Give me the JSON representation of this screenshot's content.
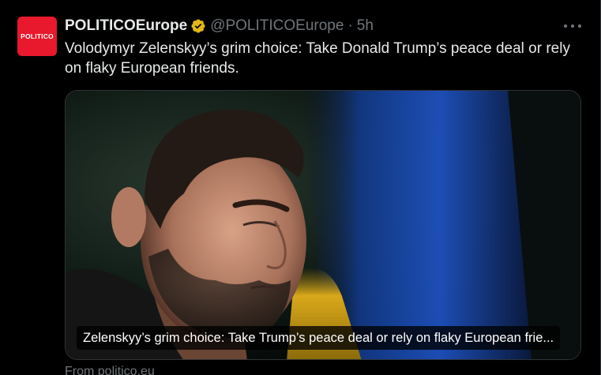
{
  "account": {
    "avatar_text": "POLITICO",
    "display_name": "POLITICOEurope",
    "handle": "@POLITICOEurope",
    "separator": "·",
    "time": "5h",
    "verified_badge": "verified-gold-badge",
    "verified_color": "#e2b719"
  },
  "tweet": {
    "text": "Volodymyr Zelenskyy’s grim choice: Take Donald Trump’s peace deal or rely on flaky European friends."
  },
  "card": {
    "image": "photo-of-zelenskyy-with-ukrainian-flag",
    "caption": "Zelenskyy’s grim choice: Take Trump’s peace deal or rely on flaky European frie..."
  },
  "source": {
    "label": "From politico.eu"
  },
  "colors": {
    "background": "#000000",
    "text_primary": "#e7e9ea",
    "text_secondary": "#71767b",
    "brand_red": "#e8192c",
    "border": "#2f3336"
  },
  "icons": {
    "more": "more-options-icon"
  }
}
